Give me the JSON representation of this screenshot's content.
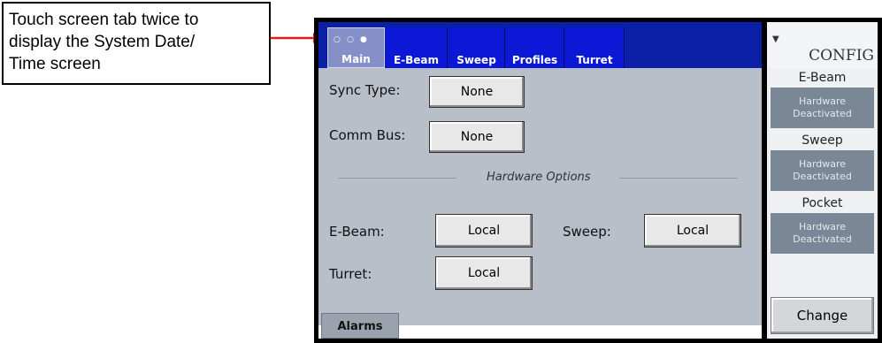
{
  "callout": {
    "lines": [
      "Touch screen tab twice to",
      "display the System Date/",
      "Time screen"
    ]
  },
  "colors": {
    "tab_active": "#8690c8",
    "tab": "#0d18d6",
    "arrow": "#e21b1b",
    "status_box": "#7a8797"
  },
  "tabs": [
    "Main",
    "E-Beam",
    "Sweep",
    "Profiles",
    "Turret"
  ],
  "main": {
    "sync_type_label": "Sync Type:",
    "sync_type_value": "None",
    "comm_bus_label": "Comm Bus:",
    "comm_bus_value": "None",
    "hardware_options_title": "Hardware Options",
    "ebeam_label": "E-Beam:",
    "ebeam_value": "Local",
    "sweep_label": "Sweep:",
    "sweep_value": "Local",
    "turret_label": "Turret:",
    "turret_value": "Local",
    "alarms_label": "Alarms"
  },
  "config": {
    "title": "CONFIG",
    "groups": [
      {
        "label": "E-Beam",
        "status_line1": "Hardware",
        "status_line2": "Deactivated"
      },
      {
        "label": "Sweep",
        "status_line1": "Hardware",
        "status_line2": "Deactivated"
      },
      {
        "label": "Pocket",
        "status_line1": "Hardware",
        "status_line2": "Deactivated"
      }
    ],
    "change_label": "Change"
  }
}
